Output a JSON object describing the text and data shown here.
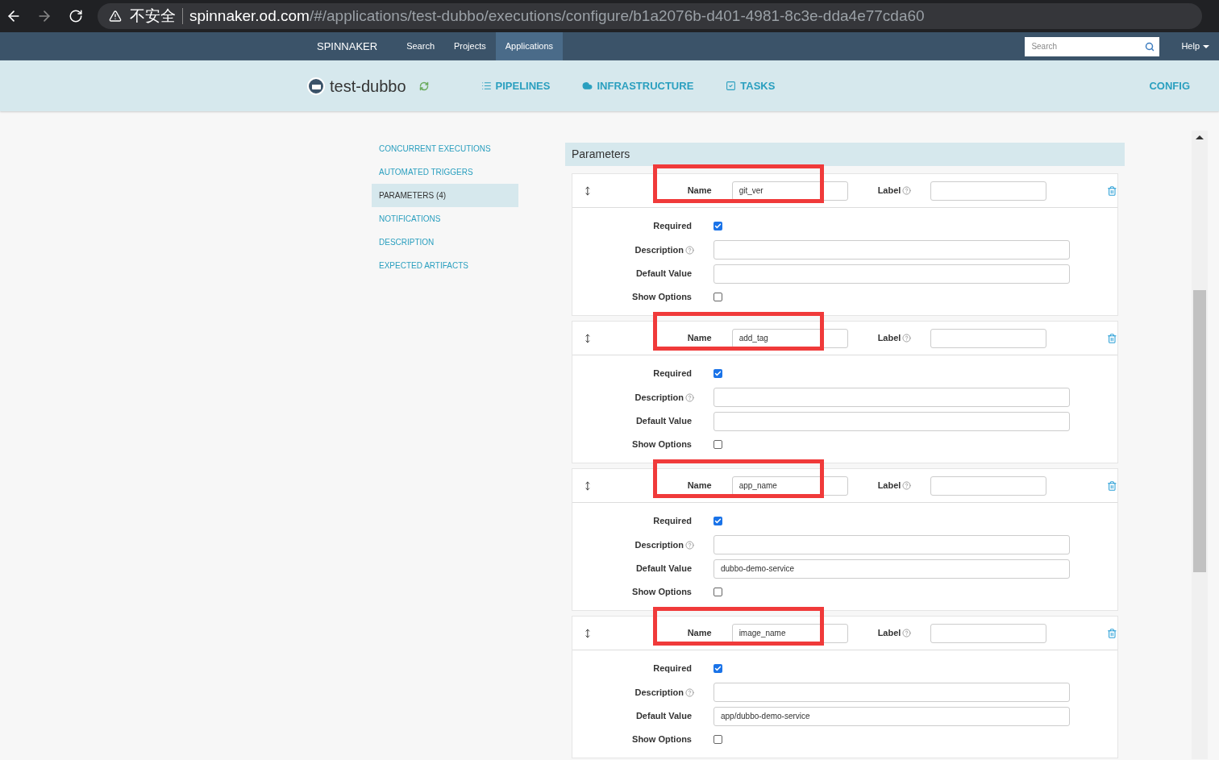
{
  "browser": {
    "security": "不安全",
    "url_host": "spinnaker.od.com",
    "url_path": "/#/applications/test-dubbo/executions/configure/b1a2076b-d401-4981-8c3e-dda4e77cda60"
  },
  "nav": {
    "brand": "SPINNAKER",
    "items": [
      {
        "label": "Search",
        "selected": false
      },
      {
        "label": "Projects",
        "selected": false
      },
      {
        "label": "Applications",
        "selected": true
      }
    ],
    "search": {
      "placeholder": "Search"
    },
    "help": "Help"
  },
  "app": {
    "name": "test-dubbo",
    "tabs": [
      {
        "label": "PIPELINES",
        "kind": "list"
      },
      {
        "label": "INFRASTRUCTURE",
        "kind": "cloud"
      },
      {
        "label": "TASKS",
        "kind": "check"
      }
    ],
    "config": "CONFIG"
  },
  "sidebar": {
    "items": [
      {
        "label": "CONCURRENT EXECUTIONS",
        "selected": false
      },
      {
        "label": "AUTOMATED TRIGGERS",
        "selected": false
      },
      {
        "label": "PARAMETERS (4)",
        "selected": true
      },
      {
        "label": "NOTIFICATIONS",
        "selected": false
      },
      {
        "label": "DESCRIPTION",
        "selected": false
      },
      {
        "label": "EXPECTED ARTIFACTS",
        "selected": false
      }
    ]
  },
  "parameters": {
    "title": "Parameters",
    "items": [
      {
        "highlighted": true,
        "name_label": "Name",
        "name": "git_ver",
        "label_label": "Label",
        "required_label": "Required",
        "required": true,
        "description_label": "Description",
        "default_value_label": "Default Value",
        "show_options_label": "Show Options",
        "show_options": false
      },
      {
        "highlighted": true,
        "name_label": "Name",
        "name": "add_tag",
        "label_label": "Label",
        "required_label": "Required",
        "required": true,
        "description_label": "Description",
        "default_value_label": "Default Value",
        "show_options_label": "Show Options",
        "show_options": false
      },
      {
        "highlighted": true,
        "name_label": "Name",
        "name": "app_name",
        "label_label": "Label",
        "required_label": "Required",
        "required": true,
        "description_label": "Description",
        "default_value_label": "Default Value",
        "default_value": "dubbo-demo-service",
        "show_options_label": "Show Options",
        "show_options": false
      },
      {
        "highlighted": true,
        "name_label": "Name",
        "name": "image_name",
        "label_label": "Label",
        "required_label": "Required",
        "required": true,
        "description_label": "Description",
        "default_value_label": "Default Value",
        "default_value": "app/dubbo-demo-service",
        "show_options_label": "Show Options",
        "show_options": false
      }
    ]
  }
}
